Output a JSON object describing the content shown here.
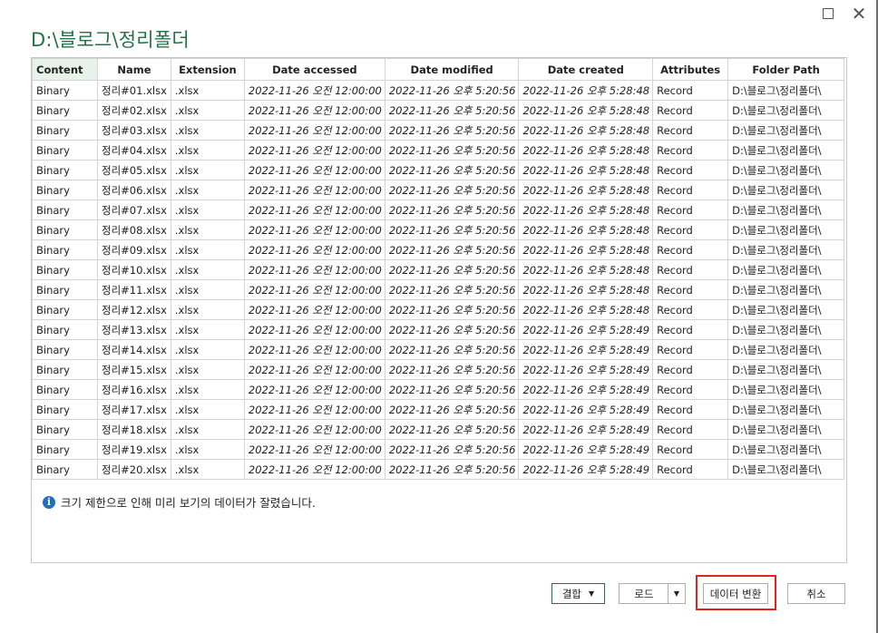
{
  "window": {
    "title": "D:\\블로그\\정리폴더",
    "maximize_icon": "maximize-icon",
    "close_icon": "close-icon",
    "close_glyph": "✕"
  },
  "table": {
    "columns": [
      "Content",
      "Name",
      "Extension",
      "Date accessed",
      "Date modified",
      "Date created",
      "Attributes",
      "Folder Path"
    ],
    "rows": [
      [
        "Binary",
        "정리#01.xlsx",
        ".xlsx",
        "2022-11-26 오전 12:00:00",
        "2022-11-26 오후 5:20:56",
        "2022-11-26 오후 5:28:48",
        "Record",
        "D:\\블로그\\정리폴더\\"
      ],
      [
        "Binary",
        "정리#02.xlsx",
        ".xlsx",
        "2022-11-26 오전 12:00:00",
        "2022-11-26 오후 5:20:56",
        "2022-11-26 오후 5:28:48",
        "Record",
        "D:\\블로그\\정리폴더\\"
      ],
      [
        "Binary",
        "정리#03.xlsx",
        ".xlsx",
        "2022-11-26 오전 12:00:00",
        "2022-11-26 오후 5:20:56",
        "2022-11-26 오후 5:28:48",
        "Record",
        "D:\\블로그\\정리폴더\\"
      ],
      [
        "Binary",
        "정리#04.xlsx",
        ".xlsx",
        "2022-11-26 오전 12:00:00",
        "2022-11-26 오후 5:20:56",
        "2022-11-26 오후 5:28:48",
        "Record",
        "D:\\블로그\\정리폴더\\"
      ],
      [
        "Binary",
        "정리#05.xlsx",
        ".xlsx",
        "2022-11-26 오전 12:00:00",
        "2022-11-26 오후 5:20:56",
        "2022-11-26 오후 5:28:48",
        "Record",
        "D:\\블로그\\정리폴더\\"
      ],
      [
        "Binary",
        "정리#06.xlsx",
        ".xlsx",
        "2022-11-26 오전 12:00:00",
        "2022-11-26 오후 5:20:56",
        "2022-11-26 오후 5:28:48",
        "Record",
        "D:\\블로그\\정리폴더\\"
      ],
      [
        "Binary",
        "정리#07.xlsx",
        ".xlsx",
        "2022-11-26 오전 12:00:00",
        "2022-11-26 오후 5:20:56",
        "2022-11-26 오후 5:28:48",
        "Record",
        "D:\\블로그\\정리폴더\\"
      ],
      [
        "Binary",
        "정리#08.xlsx",
        ".xlsx",
        "2022-11-26 오전 12:00:00",
        "2022-11-26 오후 5:20:56",
        "2022-11-26 오후 5:28:48",
        "Record",
        "D:\\블로그\\정리폴더\\"
      ],
      [
        "Binary",
        "정리#09.xlsx",
        ".xlsx",
        "2022-11-26 오전 12:00:00",
        "2022-11-26 오후 5:20:56",
        "2022-11-26 오후 5:28:48",
        "Record",
        "D:\\블로그\\정리폴더\\"
      ],
      [
        "Binary",
        "정리#10.xlsx",
        ".xlsx",
        "2022-11-26 오전 12:00:00",
        "2022-11-26 오후 5:20:56",
        "2022-11-26 오후 5:28:48",
        "Record",
        "D:\\블로그\\정리폴더\\"
      ],
      [
        "Binary",
        "정리#11.xlsx",
        ".xlsx",
        "2022-11-26 오전 12:00:00",
        "2022-11-26 오후 5:20:56",
        "2022-11-26 오후 5:28:48",
        "Record",
        "D:\\블로그\\정리폴더\\"
      ],
      [
        "Binary",
        "정리#12.xlsx",
        ".xlsx",
        "2022-11-26 오전 12:00:00",
        "2022-11-26 오후 5:20:56",
        "2022-11-26 오후 5:28:48",
        "Record",
        "D:\\블로그\\정리폴더\\"
      ],
      [
        "Binary",
        "정리#13.xlsx",
        ".xlsx",
        "2022-11-26 오전 12:00:00",
        "2022-11-26 오후 5:20:56",
        "2022-11-26 오후 5:28:49",
        "Record",
        "D:\\블로그\\정리폴더\\"
      ],
      [
        "Binary",
        "정리#14.xlsx",
        ".xlsx",
        "2022-11-26 오전 12:00:00",
        "2022-11-26 오후 5:20:56",
        "2022-11-26 오후 5:28:49",
        "Record",
        "D:\\블로그\\정리폴더\\"
      ],
      [
        "Binary",
        "정리#15.xlsx",
        ".xlsx",
        "2022-11-26 오전 12:00:00",
        "2022-11-26 오후 5:20:56",
        "2022-11-26 오후 5:28:49",
        "Record",
        "D:\\블로그\\정리폴더\\"
      ],
      [
        "Binary",
        "정리#16.xlsx",
        ".xlsx",
        "2022-11-26 오전 12:00:00",
        "2022-11-26 오후 5:20:56",
        "2022-11-26 오후 5:28:49",
        "Record",
        "D:\\블로그\\정리폴더\\"
      ],
      [
        "Binary",
        "정리#17.xlsx",
        ".xlsx",
        "2022-11-26 오전 12:00:00",
        "2022-11-26 오후 5:20:56",
        "2022-11-26 오후 5:28:49",
        "Record",
        "D:\\블로그\\정리폴더\\"
      ],
      [
        "Binary",
        "정리#18.xlsx",
        ".xlsx",
        "2022-11-26 오전 12:00:00",
        "2022-11-26 오후 5:20:56",
        "2022-11-26 오후 5:28:49",
        "Record",
        "D:\\블로그\\정리폴더\\"
      ],
      [
        "Binary",
        "정리#19.xlsx",
        ".xlsx",
        "2022-11-26 오전 12:00:00",
        "2022-11-26 오후 5:20:56",
        "2022-11-26 오후 5:28:49",
        "Record",
        "D:\\블로그\\정리폴더\\"
      ],
      [
        "Binary",
        "정리#20.xlsx",
        ".xlsx",
        "2022-11-26 오전 12:00:00",
        "2022-11-26 오후 5:20:56",
        "2022-11-26 오후 5:28:49",
        "Record",
        "D:\\블로그\\정리폴더\\"
      ]
    ]
  },
  "info": {
    "icon": "info-icon",
    "icon_glyph": "i",
    "message": "크기 제한으로 인해 미리 보기의 데이터가 잘렸습니다."
  },
  "buttons": {
    "combine": "결합",
    "combine_caret": "▼",
    "load": "로드",
    "load_caret": "▼",
    "transform": "데이터 변환",
    "cancel": "취소"
  },
  "colors": {
    "title": "#217346",
    "highlight": "#e2231a",
    "header_content_bg": "#e6f2ea",
    "info_icon": "#1f6fbf"
  }
}
